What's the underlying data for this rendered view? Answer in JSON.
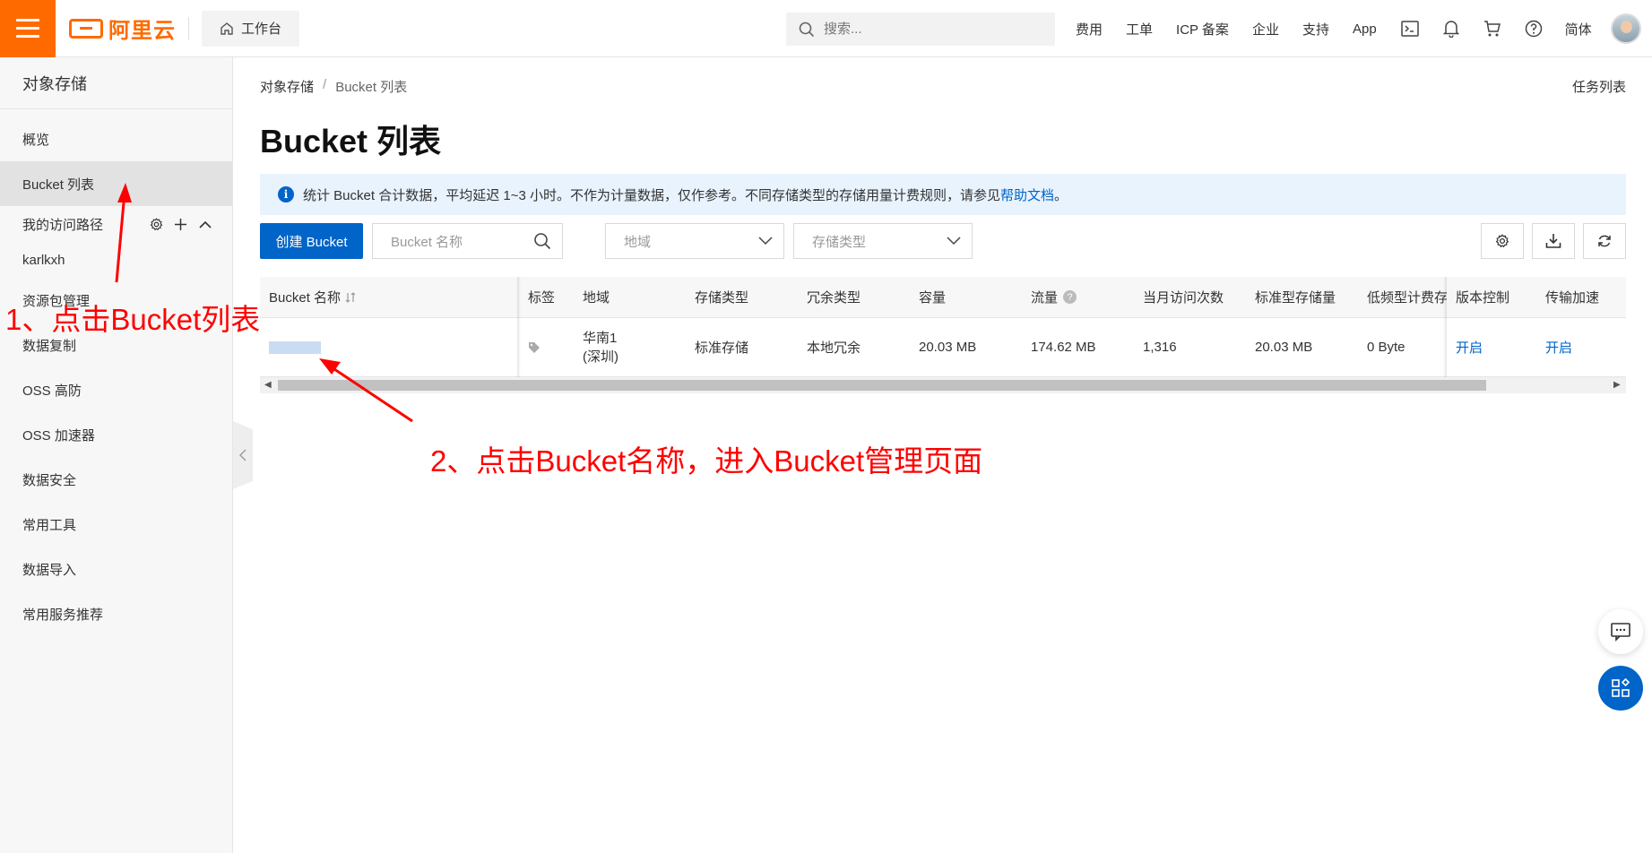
{
  "topbar": {
    "logo_text": "阿里云",
    "workbench": "工作台",
    "search_placeholder": "搜索...",
    "links": [
      "费用",
      "工单",
      "ICP 备案",
      "企业",
      "支持",
      "App"
    ],
    "lang": "简体",
    "brand_color": "#ff6a00",
    "icons": [
      "terminal-icon",
      "bell-icon",
      "cart-icon",
      "help-icon"
    ]
  },
  "sidebar": {
    "title": "对象存储",
    "items": [
      {
        "label": "概览"
      },
      {
        "label": "Bucket 列表"
      }
    ],
    "group_label": "我的访问路径",
    "group_sub": "karlkxh",
    "items2": [
      {
        "label": "资源包管理"
      },
      {
        "label": "数据复制"
      },
      {
        "label": "OSS 高防"
      },
      {
        "label": "OSS 加速器"
      },
      {
        "label": "数据安全"
      },
      {
        "label": "常用工具"
      },
      {
        "label": "数据导入"
      },
      {
        "label": "常用服务推荐"
      }
    ]
  },
  "breadcrumb": {
    "root": "对象存储",
    "sep": "/",
    "current": "Bucket 列表"
  },
  "task_list": "任务列表",
  "page_title": "Bucket 列表",
  "notice": {
    "text": "统计 Bucket 合计数据，平均延迟 1~3 小时。不作为计量数据，仅作参考。不同存储类型的存储用量计费规则，请参见",
    "link": "帮助文档",
    "end": "。",
    "color": "#e8f3fd"
  },
  "toolbar": {
    "create": "创建 Bucket",
    "name_placeholder": "Bucket 名称",
    "region_placeholder": "地域",
    "storage_placeholder": "存储类型",
    "accent": "#0064c8"
  },
  "table": {
    "headers": [
      "Bucket 名称",
      "标签",
      "地域",
      "存储类型",
      "冗余类型",
      "容量",
      "流量",
      "当月访问次数",
      "标准型存储量",
      "低频型计费存",
      "版本控制",
      "传输加速"
    ],
    "row": {
      "region_line1": "华南1",
      "region_line2": "(深圳)",
      "storage": "标准存储",
      "redundancy": "本地冗余",
      "capacity": "20.03 MB",
      "traffic": "174.62 MB",
      "visits": "1,316",
      "std_storage": "20.03 MB",
      "ia_storage": "0 Byte",
      "versioning": "开启",
      "acceleration": "开启"
    }
  },
  "annotations": {
    "step1": "1、点击Bucket列表",
    "step2": "2、点击Bucket名称，进入Bucket管理页面",
    "color": "#ff0000"
  }
}
